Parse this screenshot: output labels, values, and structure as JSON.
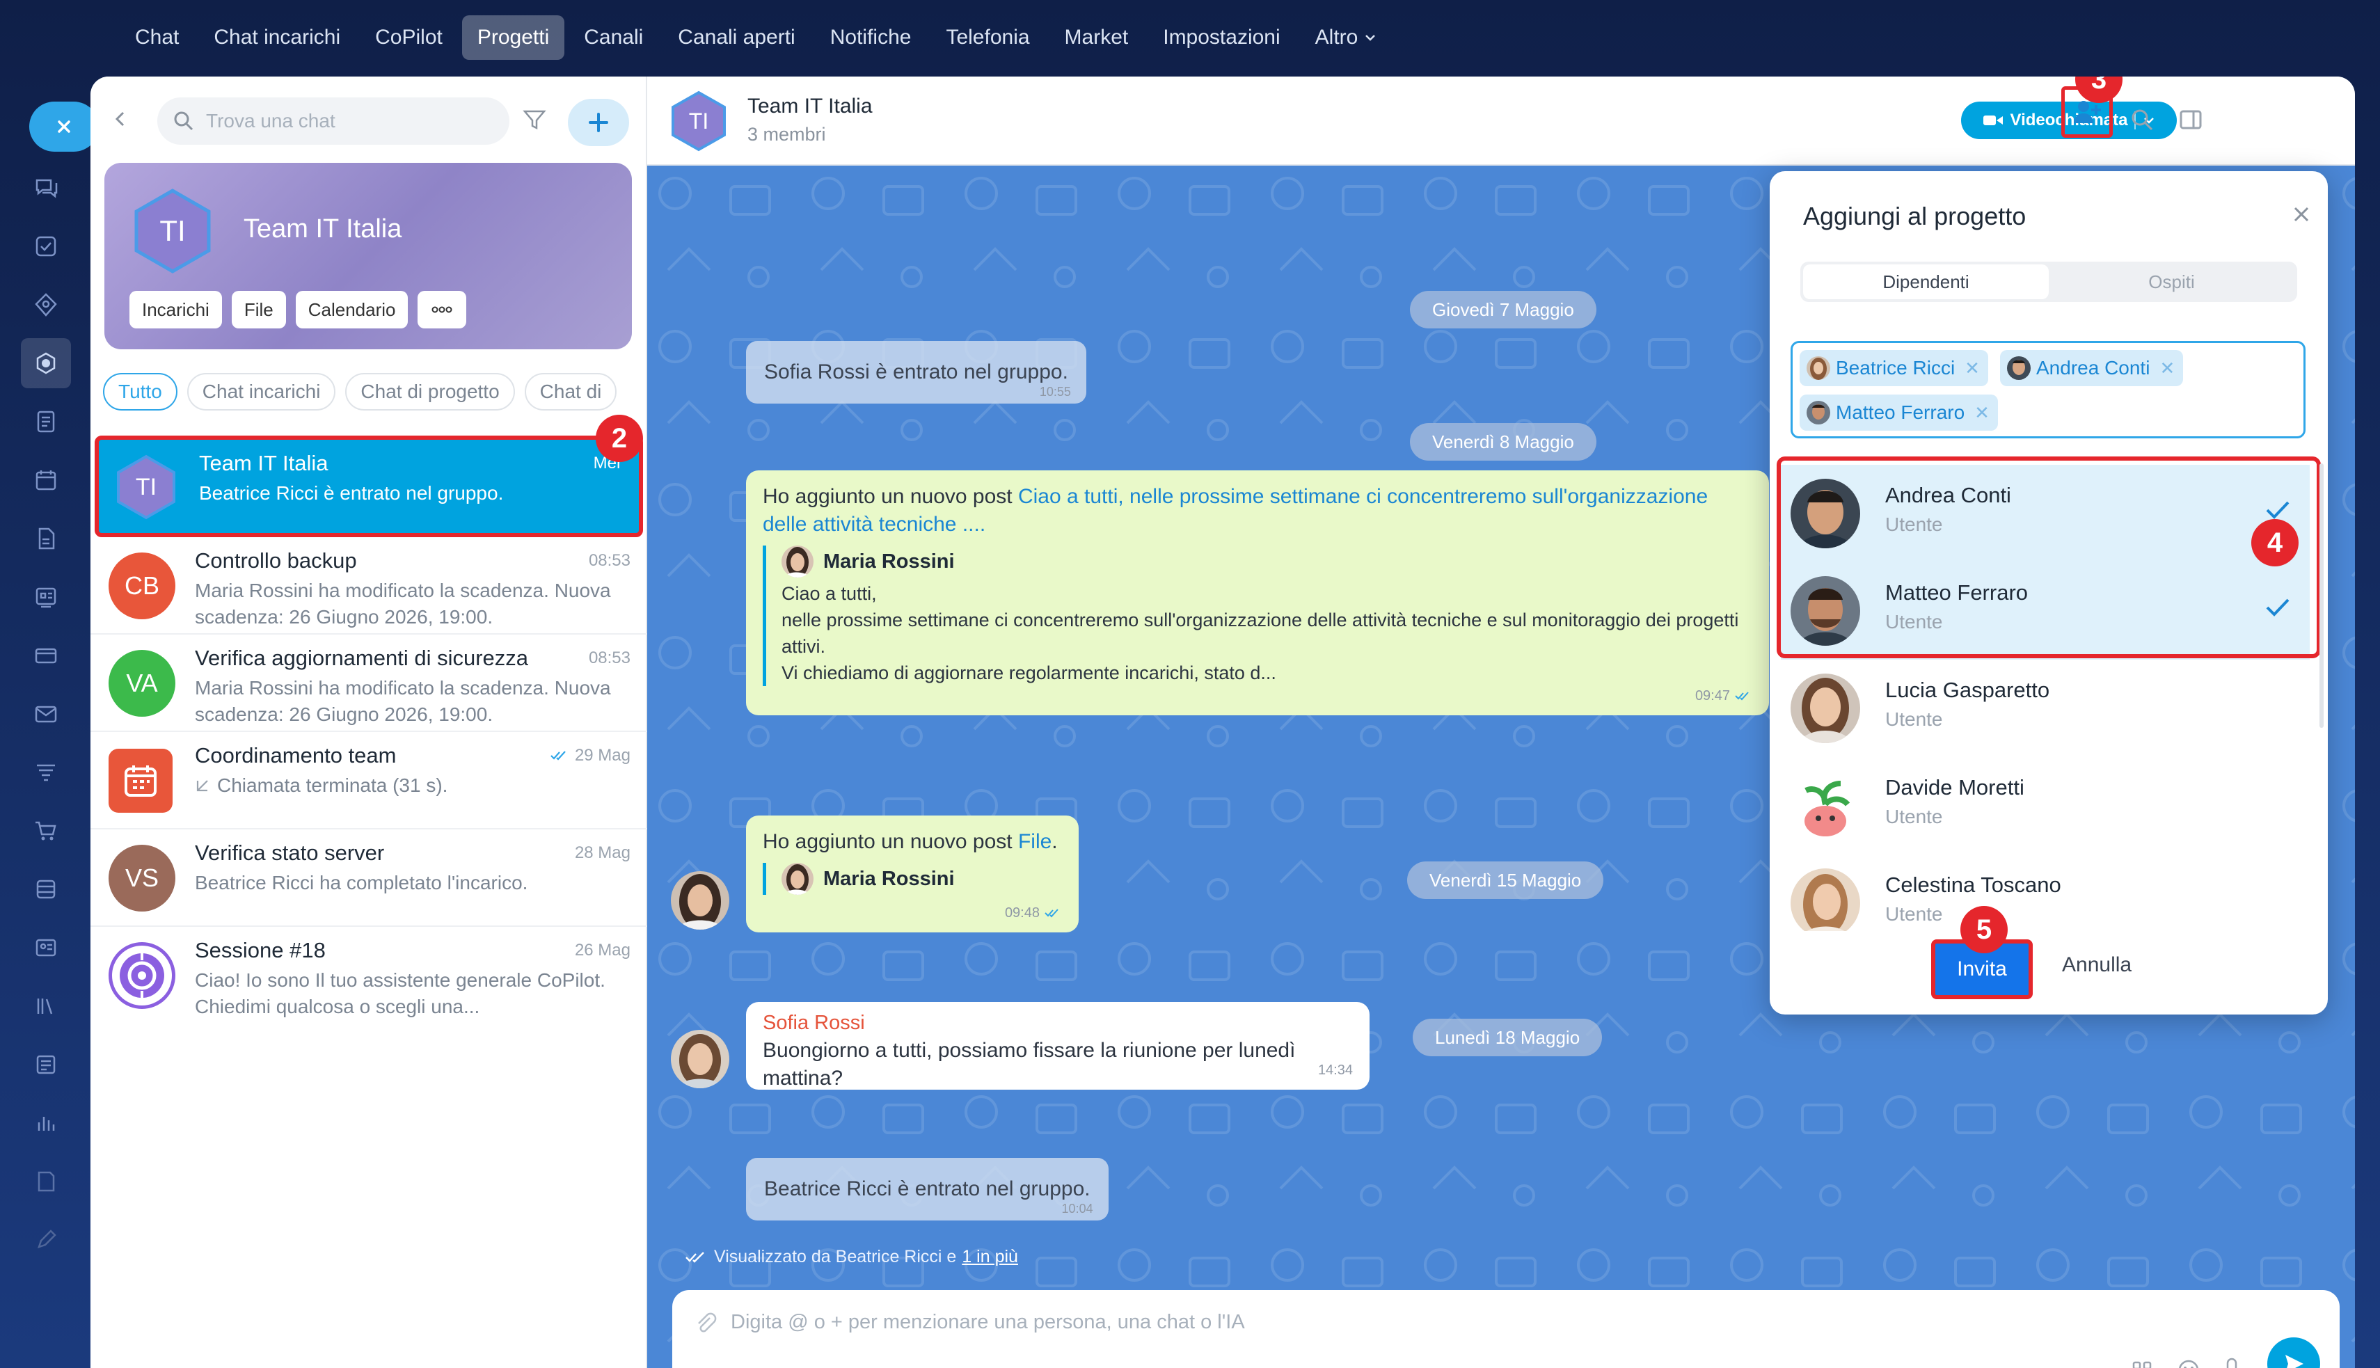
{
  "nav": {
    "items": [
      "Chat",
      "Chat incarichi",
      "CoPilot",
      "Progetti",
      "Canali",
      "Canali aperti",
      "Notifiche",
      "Telefonia",
      "Market",
      "Impostazioni"
    ],
    "active": "Progetti",
    "more": "Altro"
  },
  "sidebar": {
    "search_placeholder": "Trova una chat",
    "project_card": {
      "initials": "TI",
      "title": "Team IT Italia",
      "buttons": [
        "Incarichi",
        "File",
        "Calendario"
      ]
    },
    "filters": [
      "Tutto",
      "Chat incarichi",
      "Chat di progetto",
      "Chat di"
    ],
    "chats": [
      {
        "initials": "TI",
        "title": "Team IT Italia",
        "time": "Mer",
        "preview": "Beatrice Ricci è entrato nel gruppo."
      },
      {
        "initials": "CB",
        "title": "Controllo backup",
        "time": "08:53",
        "preview": "Maria Rossini ha modificato la scadenza. Nuova scadenza: 26 Giugno 2026, 19:00."
      },
      {
        "initials": "VA",
        "title": "Verifica aggiornamenti di sicurezza",
        "time": "08:53",
        "preview": "Maria Rossini ha modificato la scadenza. Nuova scadenza: 26 Giugno 2026, 19:00."
      },
      {
        "initials": "",
        "title": "Coordinamento team",
        "time": "29 Mag",
        "preview": "Chiamata terminata (31 s)."
      },
      {
        "initials": "VS",
        "title": "Verifica stato server",
        "time": "28 Mag",
        "preview": "Beatrice Ricci ha completato l'incarico."
      },
      {
        "initials": "",
        "title": "Sessione #18",
        "time": "26 Mag",
        "preview": "Ciao! Io sono Il tuo assistente generale CoPilot. Chiedimi qualcosa o scegli una..."
      }
    ]
  },
  "badges": {
    "b2": "2",
    "b3": "3",
    "b4": "4",
    "b5": "5"
  },
  "chat": {
    "title": "Team IT Italia",
    "subtitle": "3 membri",
    "video_label": "Videochiamata",
    "dates": [
      "Giovedì 7 Maggio",
      "Venerdì 8 Maggio",
      "Venerdì 15 Maggio",
      "Lunedì 18 Maggio"
    ],
    "sys1": {
      "text": "Sofia Rossi è entrato nel gruppo.",
      "time": "10:55"
    },
    "post1": {
      "intro": "Ho aggiunto un nuovo post ",
      "link": "Ciao a tutti, nelle prossime settimane ci concentreremo sull'organizzazione delle attività tecniche ....",
      "author": "Maria Rossini",
      "quote": "Ciao a tutti,\nnelle prossime settimane ci concentreremo sull'organizzazione delle attività tecniche e sul monitoraggio dei progetti attivi.\nVi chiediamo di aggiornare regolarmente incarichi, stato d...",
      "time": "09:47"
    },
    "post2": {
      "intro": "Ho aggiunto un nuovo post ",
      "link": "File",
      "punct": ".",
      "author": "Maria Rossini",
      "time": "09:48"
    },
    "msg": {
      "author": "Sofia Rossi",
      "text": "Buongiorno a tutti, possiamo fissare la riunione per lunedì mattina?",
      "time": "14:34"
    },
    "sys2": {
      "text": "Beatrice Ricci è entrato nel gruppo.",
      "time": "10:04"
    },
    "seen_prefix": "Visualizzato da Beatrice Ricci e ",
    "seen_more": "1 in più",
    "composer_placeholder": "Digita @ o + per menzionare una persona, una chat o l'IA"
  },
  "modal": {
    "title": "Aggiungi al progetto",
    "tabs": [
      "Dipendenti",
      "Ospiti"
    ],
    "tags": [
      "Beatrice Ricci",
      "Andrea Conti",
      "Matteo Ferraro"
    ],
    "people": [
      {
        "name": "Andrea Conti",
        "role": "Utente",
        "checked": true
      },
      {
        "name": "Matteo Ferraro",
        "role": "Utente",
        "checked": true
      },
      {
        "name": "Lucia Gasparetto",
        "role": "Utente",
        "checked": false
      },
      {
        "name": "Davide Moretti",
        "role": "Utente",
        "checked": false
      },
      {
        "name": "Celestina Toscano",
        "role": "Utente",
        "checked": false
      }
    ],
    "invite_label": "Invita",
    "cancel_label": "Annulla"
  },
  "colors": {
    "accent": "#00a3df",
    "highlight": "#e5262c",
    "chat_bg": "#4b87d6",
    "post_bg": "#e9f9c9",
    "project_purple": "#8b7fd1"
  }
}
